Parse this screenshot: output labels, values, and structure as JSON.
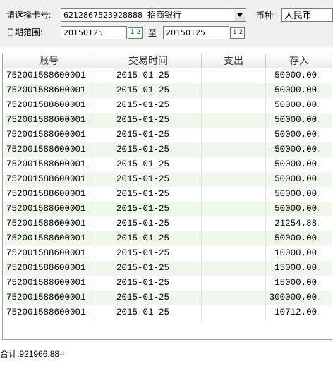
{
  "filter": {
    "card_label": "请选择卡号:",
    "card_value": "6212867523928888",
    "bank_name": "招商银行",
    "currency_label": "币种:",
    "currency_value": "人民币",
    "date_label": "日期范围:",
    "date_from": "20150125",
    "date_sep": "至",
    "date_to": "20150125",
    "calendar_button": "1 2"
  },
  "table": {
    "columns": [
      "账号",
      "交易时间",
      "支出",
      "存入"
    ],
    "rows": [
      {
        "account": "752001588600001",
        "time": "2015-01-25",
        "expense": "",
        "deposit": "50000.00"
      },
      {
        "account": "752001588600001",
        "time": "2015-01-25",
        "expense": "",
        "deposit": "50000.00"
      },
      {
        "account": "752001588600001",
        "time": "2015-01-25",
        "expense": "",
        "deposit": "50000.00"
      },
      {
        "account": "752001588600001",
        "time": "2015-01-25",
        "expense": "",
        "deposit": "50000.00"
      },
      {
        "account": "752001588600001",
        "time": "2015-01-25",
        "expense": "",
        "deposit": "50000.00"
      },
      {
        "account": "752001588600001",
        "time": "2015-01-25",
        "expense": "",
        "deposit": "50000.00"
      },
      {
        "account": "752001588600001",
        "time": "2015-01-25",
        "expense": "",
        "deposit": "50000.00"
      },
      {
        "account": "752001588600001",
        "time": "2015-01-25",
        "expense": "",
        "deposit": "50000.00"
      },
      {
        "account": "752001588600001",
        "time": "2015-01-25",
        "expense": "",
        "deposit": "50000.00"
      },
      {
        "account": "752001588600001",
        "time": "2015-01-25",
        "expense": "",
        "deposit": "50000.00"
      },
      {
        "account": "752001588600001",
        "time": "2015-01-25",
        "expense": "",
        "deposit": "21254.88"
      },
      {
        "account": "752001588600001",
        "time": "2015-01-25",
        "expense": "",
        "deposit": "50000.00"
      },
      {
        "account": "752001588600001",
        "time": "2015-01-25",
        "expense": "",
        "deposit": "10000.00"
      },
      {
        "account": "752001588600001",
        "time": "2015-01-25",
        "expense": "",
        "deposit": "15000.00"
      },
      {
        "account": "752001588600001",
        "time": "2015-01-25",
        "expense": "",
        "deposit": "15000.00"
      },
      {
        "account": "752001588600001",
        "time": "2015-01-25",
        "expense": "",
        "deposit": "300000.00"
      },
      {
        "account": "752001588600001",
        "time": "2015-01-25",
        "expense": "",
        "deposit": "10712.00"
      }
    ]
  },
  "footer": {
    "total_label": "合计:",
    "total_value": "921966.88"
  },
  "colors": {
    "alt_row": "#f0f7ec",
    "panel_bg": "#f0f0f0"
  }
}
